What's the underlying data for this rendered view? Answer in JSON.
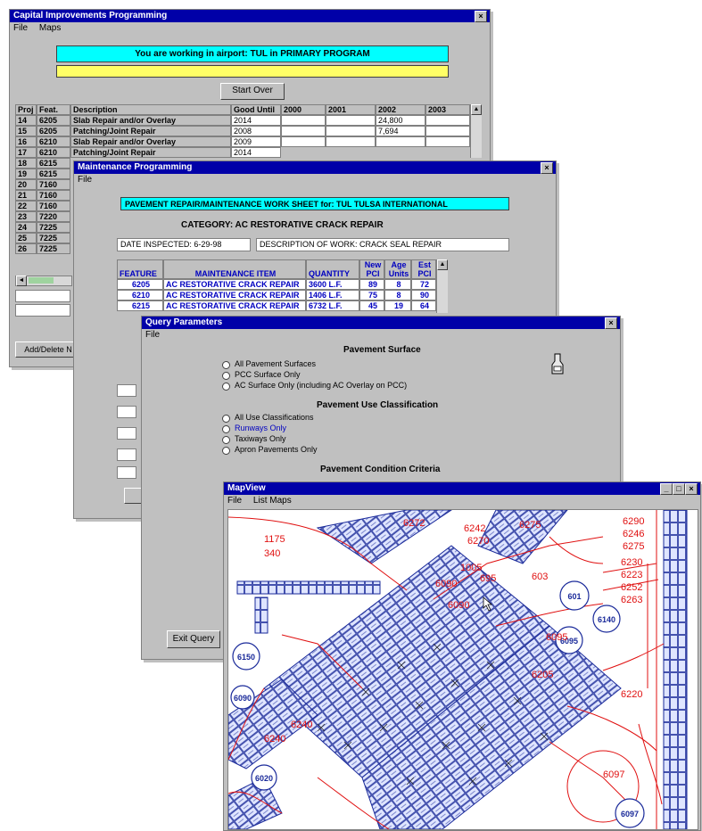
{
  "cip": {
    "title": "Capital Improvements Programming",
    "menu": [
      "File",
      "Maps"
    ],
    "banner": "You are working in airport:  TUL  in PRIMARY PROGRAM",
    "start_button": "Start Over",
    "columns": [
      "Proj",
      "Feat.",
      "Description",
      "Good Until",
      "2000",
      "2001",
      "2002",
      "2003"
    ],
    "rows": [
      {
        "proj": "14",
        "feat": "6205",
        "desc": "Slab Repair and/or Overlay",
        "good": "2014",
        "y2002": "24,800"
      },
      {
        "proj": "15",
        "feat": "6205",
        "desc": "Patching/Joint Repair",
        "good": "2008",
        "y2002": "7,694"
      },
      {
        "proj": "16",
        "feat": "6210",
        "desc": "Slab Repair and/or Overlay",
        "good": "2009",
        "y2002": ""
      },
      {
        "proj": "17",
        "feat": "6210",
        "desc": "Patching/Joint Repair",
        "good": "2014",
        "y2002": ""
      }
    ],
    "more_proj": [
      "18",
      "19",
      "20",
      "21",
      "22",
      "23",
      "24",
      "25",
      "26"
    ],
    "more_feat": [
      "6215",
      "6215",
      "7160",
      "7160",
      "7160",
      "7220",
      "7225",
      "7225",
      "7225"
    ],
    "add_button": "Add/Delete N"
  },
  "maint": {
    "title": "Maintenance Programming",
    "menu": [
      "File"
    ],
    "banner": "PAVEMENT REPAIR/MAINTENANCE WORK SHEET for: TUL TULSA INTERNATIONAL",
    "category": "CATEGORY:  AC RESTORATIVE CRACK REPAIR",
    "date_field": "DATE INSPECTED: 6-29-98",
    "desc_field": "DESCRIPTION OF WORK: CRACK SEAL REPAIR",
    "columns": [
      "FEATURE",
      "MAINTENANCE ITEM",
      "QUANTITY",
      "New PCI",
      "Age Units",
      "Est PCI"
    ],
    "rows": [
      {
        "feature": "6205",
        "item": "AC RESTORATIVE CRACK REPAIR",
        "qty": "3600 L.F.",
        "pci": "89",
        "age": "8",
        "est": "72"
      },
      {
        "feature": "6210",
        "item": "AC RESTORATIVE CRACK REPAIR",
        "qty": "1406 L.F.",
        "pci": "75",
        "age": "8",
        "est": "90"
      },
      {
        "feature": "6215",
        "item": "AC RESTORATIVE CRACK REPAIR",
        "qty": "6732 L.F.",
        "pci": "45",
        "age": "19",
        "est": "64"
      }
    ]
  },
  "query": {
    "title": "Query Parameters",
    "menu": [
      "File"
    ],
    "surface_title": "Pavement Surface",
    "surface_options": [
      "All Pavement Surfaces",
      "PCC Surface Only",
      "AC Surface Only (including AC Overlay on PCC)"
    ],
    "use_title": "Pavement Use Classification",
    "use_options": [
      "All Use Classifications",
      "Runways Only",
      "Taxiways Only",
      "Apron Pavements Only"
    ],
    "condition_title": "Pavement Condition Criteria",
    "exit_button": "Exit Query"
  },
  "mapview": {
    "title": "MapView",
    "menu": [
      "File",
      "List Maps"
    ],
    "red_labels": [
      "6290",
      "6246",
      "6275",
      "6272",
      "6242",
      "6275",
      "6270",
      "1175",
      "340",
      "1005",
      "6090",
      "695",
      "603",
      "6230",
      "6223",
      "6252",
      "6263",
      "6205",
      "6240",
      "6220",
      "6095",
      "6097",
      "6240",
      "6090"
    ],
    "circle_labels": [
      "601",
      "6140",
      "6095",
      "6150",
      "6090",
      "6020",
      "6097"
    ]
  },
  "colors": {
    "title_bar": "#0000a8",
    "banner_cyan": "#00ffff",
    "banner_yellow": "#ffff66",
    "map_red": "#e01010",
    "map_blue": "#1a2a9a"
  }
}
